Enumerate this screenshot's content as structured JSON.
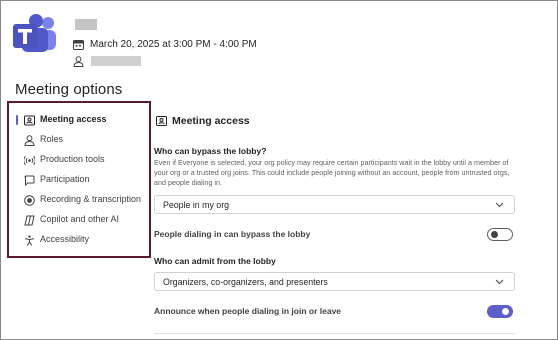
{
  "header": {
    "date_time": "March 20, 2025 at 3:00 PM - 4:00 PM"
  },
  "page_title": "Meeting options",
  "sidebar": {
    "items": [
      {
        "label": "Meeting access",
        "icon": "meeting-access-icon",
        "selected": true
      },
      {
        "label": "Roles",
        "icon": "person-icon",
        "selected": false
      },
      {
        "label": "Production tools",
        "icon": "broadcast-icon",
        "selected": false
      },
      {
        "label": "Participation",
        "icon": "chat-icon",
        "selected": false
      },
      {
        "label": "Recording & transcription",
        "icon": "record-icon",
        "selected": false
      },
      {
        "label": "Copilot and other AI",
        "icon": "copilot-icon",
        "selected": false
      },
      {
        "label": "Accessibility",
        "icon": "accessibility-icon",
        "selected": false
      }
    ]
  },
  "main": {
    "section_title": "Meeting access",
    "bypass_lobby": {
      "label": "Who can bypass the lobby?",
      "help": "Even if Everyone is selected, your org policy may require certain participants wait in the lobby until a member of your org or a trusted org joins. This could include people joining without an account, people from untrusted orgs, and people dialing in.",
      "value": "People in my org"
    },
    "dial_in_bypass": {
      "label": "People dialing in can bypass the lobby",
      "on": false
    },
    "admit_from_lobby": {
      "label": "Who can admit from the lobby",
      "value": "Organizers, co-organizers, and presenters"
    },
    "announce_dial_in": {
      "label": "Announce when people dialing in join or leave",
      "on": true
    }
  },
  "colors": {
    "accent": "#5b5fc7",
    "sidebar_border": "#5c1a2e",
    "teams_purple": "#4b53bc"
  }
}
